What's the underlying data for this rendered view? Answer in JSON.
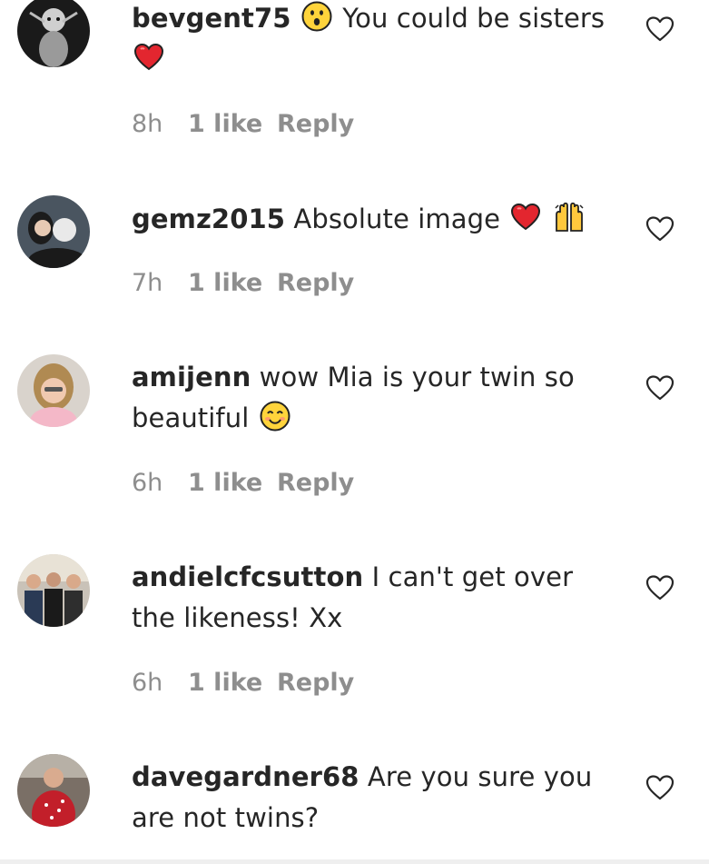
{
  "comments": [
    {
      "username": "bevgent75",
      "text_before": "",
      "text": "You could be sisters",
      "time": "8h",
      "likes": "1 like",
      "reply": "Reply",
      "emojis": [
        "astonished-face",
        "red-heart"
      ]
    },
    {
      "username": "gemz2015",
      "text": "Absolute image",
      "time": "7h",
      "likes": "1 like",
      "reply": "Reply",
      "emojis": [
        "red-heart",
        "raising-hands"
      ]
    },
    {
      "username": "amijenn",
      "text": "wow Mia is your twin so beautiful",
      "time": "6h",
      "likes": "1 like",
      "reply": "Reply",
      "emojis": [
        "smiling-face"
      ]
    },
    {
      "username": "andielcfcsutton",
      "text": "I can't get over the likeness! Xx",
      "time": "6h",
      "likes": "1 like",
      "reply": "Reply",
      "emojis": []
    },
    {
      "username": "davegardner68",
      "text": "Are you sure you are not twins?",
      "time": "",
      "likes": "",
      "reply": "",
      "emojis": []
    }
  ],
  "colors": {
    "text": "#262626",
    "meta": "#8e8e8e",
    "heart_emoji": "#e3262f",
    "like_icon_stroke": "#262626"
  },
  "icons": {
    "like": "heart-outline-icon"
  }
}
